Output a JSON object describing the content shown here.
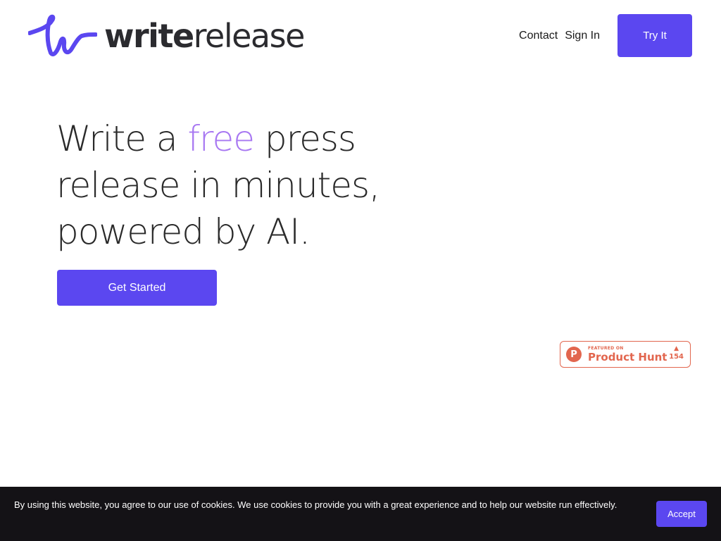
{
  "header": {
    "logo": {
      "bold": "write",
      "light": "release",
      "icon": "writerelease-logo-icon"
    },
    "nav": {
      "contact": "Contact",
      "signin": "Sign In",
      "try_it": "Try It"
    }
  },
  "hero": {
    "line_part1": "Write a ",
    "line_accent": "free",
    "line_part2": " press release in minutes, powered by AI.",
    "cta": "Get Started"
  },
  "product_hunt": {
    "featured": "FEATURED ON",
    "name": "Product Hunt",
    "votes": "154",
    "icon": "product-hunt-icon"
  },
  "cookie": {
    "text": "By using this website, you agree to our use of cookies. We use cookies to provide you with a great experience and to help our website run effectively.",
    "accept": "Accept"
  },
  "colors": {
    "primary": "#5b47f0",
    "accent": "#a878f2",
    "product_hunt": "#e2664e",
    "banner": "#141216"
  }
}
